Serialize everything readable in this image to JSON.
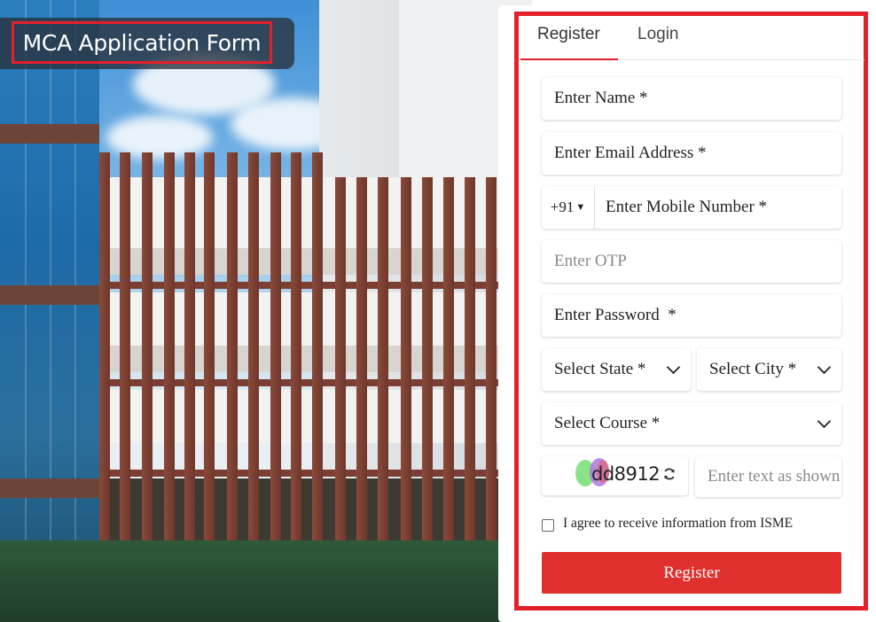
{
  "header": {
    "title": "MCA Application Form"
  },
  "tabs": [
    {
      "label": "Register",
      "active": true
    },
    {
      "label": "Login",
      "active": false
    }
  ],
  "form": {
    "name_placeholder": "Enter Name *",
    "email_placeholder": "Enter Email Address *",
    "country_code": "+91",
    "mobile_placeholder": "Enter Mobile Number *",
    "otp_placeholder": "Enter OTP",
    "password_placeholder": "Enter Password  *",
    "state_label": "Select State *",
    "city_label": "Select City *",
    "course_label": "Select Course *",
    "captcha_code": "dd8912",
    "captcha_placeholder": "Enter text as shown",
    "agree_text": "I agree to receive information from ISME",
    "submit_label": "Register"
  },
  "colors": {
    "accent": "#e3202a",
    "button": "#e0302e"
  },
  "icons": [
    "chevron-down-icon",
    "refresh-icon",
    "caret-down-icon"
  ]
}
